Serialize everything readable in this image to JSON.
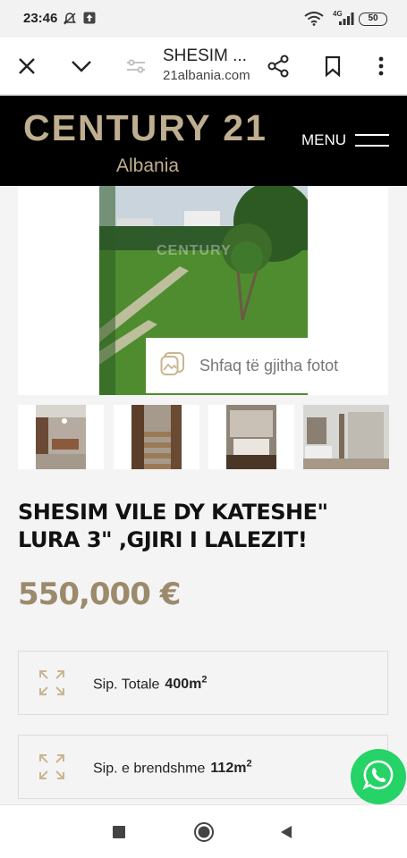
{
  "status_bar": {
    "time": "23:46",
    "network": "4G",
    "battery": "50"
  },
  "browser": {
    "title": "SHESIM ...",
    "url": "21albania.com",
    "icons": [
      "close-icon",
      "chevron-down-icon",
      "site-settings-icon",
      "share-icon",
      "bookmark-icon",
      "more-vert-icon"
    ]
  },
  "site": {
    "logo_main": "CENTURY 21",
    "logo_sub": "Albania",
    "menu_label": "MENU",
    "brand_color": "#bfae8f"
  },
  "gallery": {
    "watermark": "CENTURY",
    "show_all_label": "Shfaq të gjitha fotot",
    "thumbnails": [
      "living-room-photo",
      "staircase-photo",
      "bedroom-photo",
      "bathroom-photo"
    ]
  },
  "listing": {
    "title": "SHESIM VILE DY KATESHE\" LURA 3\" ,GJIRI I LALEZIT!",
    "price": "550,000 €",
    "price_color": "#9c8a6c",
    "specs": [
      {
        "label": "Sip. Totale",
        "value": "400m",
        "unit_sup": "2",
        "icon": "expand-arrows-icon"
      },
      {
        "label": "Sip. e brendshme",
        "value": "112m",
        "unit_sup": "2",
        "icon": "expand-arrows-icon"
      }
    ]
  },
  "floating": {
    "icon": "whatsapp-icon",
    "color": "#25d366"
  },
  "system_nav": [
    "recents-square-icon",
    "home-circle-icon",
    "back-triangle-icon"
  ]
}
